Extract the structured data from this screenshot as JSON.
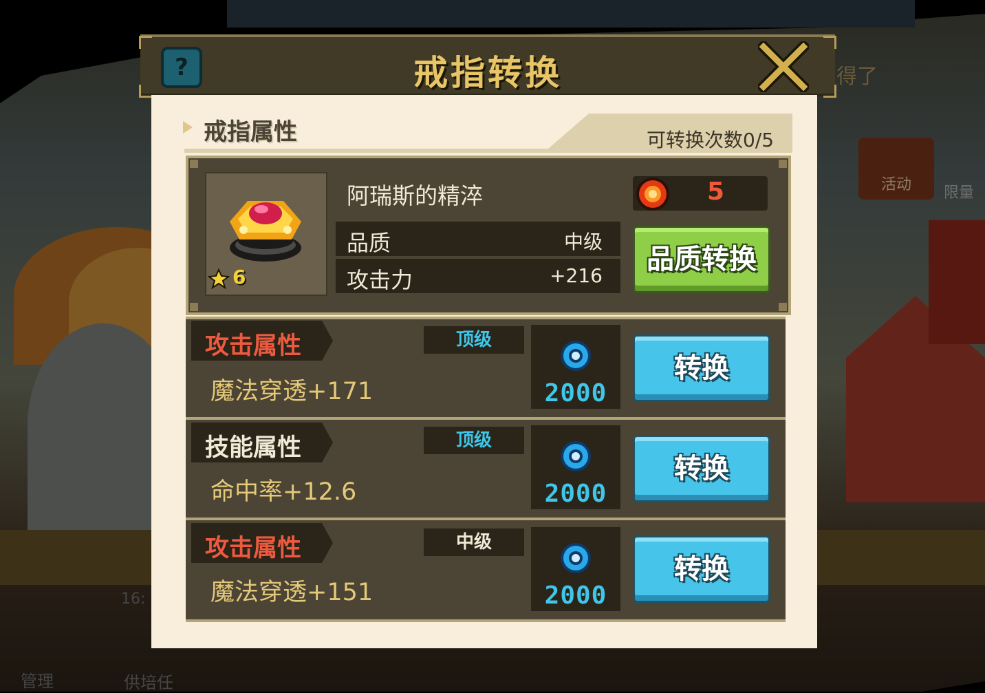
{
  "dialog": {
    "title": "戒指转换",
    "help_label": "?"
  },
  "section": {
    "label": "戒指属性",
    "convert_count": "可转换次数0/5"
  },
  "ring": {
    "name": "阿瑞斯的精淬",
    "star_level": "6",
    "essence_count": "5",
    "stats": [
      {
        "label": "品质",
        "value": "中级"
      },
      {
        "label": "攻击力",
        "value": "+216"
      }
    ],
    "quality_button": "品质转换"
  },
  "attributes": [
    {
      "type": "攻击属性",
      "type_color": "#ee5a3f",
      "grade": "顶级",
      "grade_color": "#3fc6e9",
      "value": "魔法穿透+171",
      "cost": "2000",
      "button": "转换"
    },
    {
      "type": "技能属性",
      "type_color": "#f1ead7",
      "grade": "顶级",
      "grade_color": "#3fc6e9",
      "value": "命中率+12.6",
      "cost": "2000",
      "button": "转换"
    },
    {
      "type": "攻击属性",
      "type_color": "#ee5a3f",
      "grade": "中级",
      "grade_color": "#f1ead7",
      "value": "魔法穿透+151",
      "cost": "2000",
      "button": "转换"
    }
  ],
  "background": {
    "side_text": "得了",
    "event_label": "活动",
    "limit_label": "限量",
    "bottom_left": "管理",
    "bottom_mid": "供培任",
    "top_number": "16:"
  }
}
